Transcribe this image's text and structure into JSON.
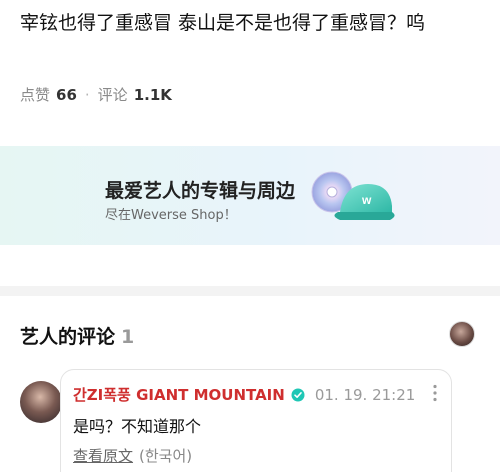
{
  "post": {
    "text": "宰铉也得了重感冒 泰山是不是也得了重感冒？呜"
  },
  "stats": {
    "likes_label": "点赞",
    "likes_count": "66",
    "separator": "·",
    "comments_label": "评论",
    "comments_count": "1.1K"
  },
  "banner": {
    "title": "最爱艺人的专辑与周边",
    "subtitle": "尽在Weverse Shop！",
    "art_icon": "album-and-cap-icon"
  },
  "artist_comments": {
    "title": "艺人的评论",
    "count": "1"
  },
  "comment": {
    "author": "간ZI폭풍 GIANT MOUNTAIN",
    "date": "01. 19. 21:21",
    "text": "是吗？不知道那个",
    "translate_label": "查看原文",
    "language": "(한국어)"
  },
  "colors": {
    "artist_name": "#cf2e2e",
    "verified_badge": "#1fc7b5",
    "muted": "#8a8a8a"
  }
}
